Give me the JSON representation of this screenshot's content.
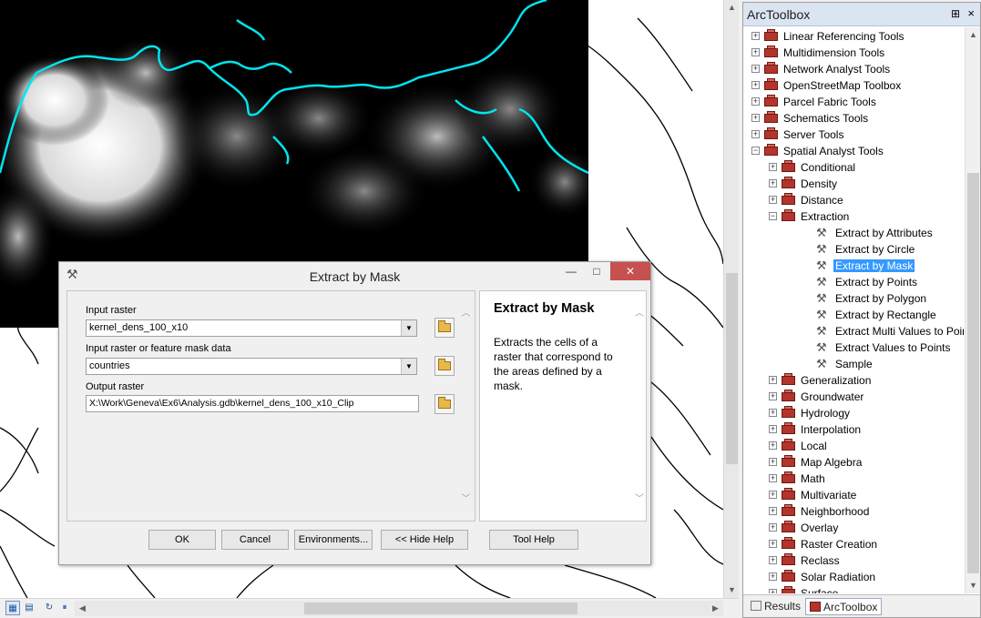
{
  "toolbox": {
    "title": "ArcToolbox",
    "pin": "⊞",
    "close": "×",
    "items": [
      {
        "label": "Linear Referencing Tools",
        "kind": "toolbox",
        "expander": "+"
      },
      {
        "label": "Multidimension Tools",
        "kind": "toolbox",
        "expander": "+"
      },
      {
        "label": "Network Analyst Tools",
        "kind": "toolbox",
        "expander": "+"
      },
      {
        "label": "OpenStreetMap Toolbox",
        "kind": "toolbox",
        "expander": "+"
      },
      {
        "label": "Parcel Fabric Tools",
        "kind": "toolbox",
        "expander": "+"
      },
      {
        "label": "Schematics Tools",
        "kind": "toolbox",
        "expander": "+"
      },
      {
        "label": "Server Tools",
        "kind": "toolbox",
        "expander": "+"
      },
      {
        "label": "Spatial Analyst Tools",
        "kind": "toolbox",
        "expander": "−"
      },
      {
        "label": "Conditional",
        "kind": "toolset",
        "expander": "+"
      },
      {
        "label": "Density",
        "kind": "toolset",
        "expander": "+"
      },
      {
        "label": "Distance",
        "kind": "toolset",
        "expander": "+"
      },
      {
        "label": "Extraction",
        "kind": "toolset",
        "expander": "−"
      },
      {
        "label": "Extract by Attributes",
        "kind": "tool"
      },
      {
        "label": "Extract by Circle",
        "kind": "tool"
      },
      {
        "label": "Extract by Mask",
        "kind": "tool",
        "selected": true
      },
      {
        "label": "Extract by Points",
        "kind": "tool"
      },
      {
        "label": "Extract by Polygon",
        "kind": "tool"
      },
      {
        "label": "Extract by Rectangle",
        "kind": "tool"
      },
      {
        "label": "Extract Multi Values to Points",
        "kind": "tool"
      },
      {
        "label": "Extract Values to Points",
        "kind": "tool"
      },
      {
        "label": "Sample",
        "kind": "tool"
      },
      {
        "label": "Generalization",
        "kind": "toolset",
        "expander": "+"
      },
      {
        "label": "Groundwater",
        "kind": "toolset",
        "expander": "+"
      },
      {
        "label": "Hydrology",
        "kind": "toolset",
        "expander": "+"
      },
      {
        "label": "Interpolation",
        "kind": "toolset",
        "expander": "+"
      },
      {
        "label": "Local",
        "kind": "toolset",
        "expander": "+"
      },
      {
        "label": "Map Algebra",
        "kind": "toolset",
        "expander": "+"
      },
      {
        "label": "Math",
        "kind": "toolset",
        "expander": "+"
      },
      {
        "label": "Multivariate",
        "kind": "toolset",
        "expander": "+"
      },
      {
        "label": "Neighborhood",
        "kind": "toolset",
        "expander": "+"
      },
      {
        "label": "Overlay",
        "kind": "toolset",
        "expander": "+"
      },
      {
        "label": "Raster Creation",
        "kind": "toolset",
        "expander": "+"
      },
      {
        "label": "Reclass",
        "kind": "toolset",
        "expander": "+"
      },
      {
        "label": "Solar Radiation",
        "kind": "toolset",
        "expander": "+"
      },
      {
        "label": "Surface",
        "kind": "toolset",
        "expander": "+"
      }
    ],
    "tabs": {
      "results": "Results",
      "arctoolbox": "ArcToolbox"
    }
  },
  "dialog": {
    "title": "Extract by Mask",
    "icon": "hammer-icon",
    "window_buttons": {
      "minimize": "—",
      "maximize": "□",
      "close": "✕"
    },
    "fields": {
      "input_raster_label": "Input raster",
      "input_raster_value": "kernel_dens_100_x10",
      "mask_label": "Input raster or feature mask data",
      "mask_value": "countries",
      "output_label": "Output raster",
      "output_value": "X:\\Work\\Geneva\\Ex6\\Analysis.gdb\\kernel_dens_100_x10_Clip"
    },
    "help": {
      "title": "Extract by Mask",
      "text": "Extracts the cells of a raster that correspond to the areas defined by a mask."
    },
    "buttons": {
      "ok": "OK",
      "cancel": "Cancel",
      "environments": "Environments...",
      "hide_help": "<< Hide Help",
      "tool_help": "Tool Help"
    }
  },
  "colors": {
    "coastline": "#00e5ee",
    "selection": "#3399ff",
    "toolbox_header": "#dbe4f1",
    "toolbox_red": "#b3342a"
  }
}
